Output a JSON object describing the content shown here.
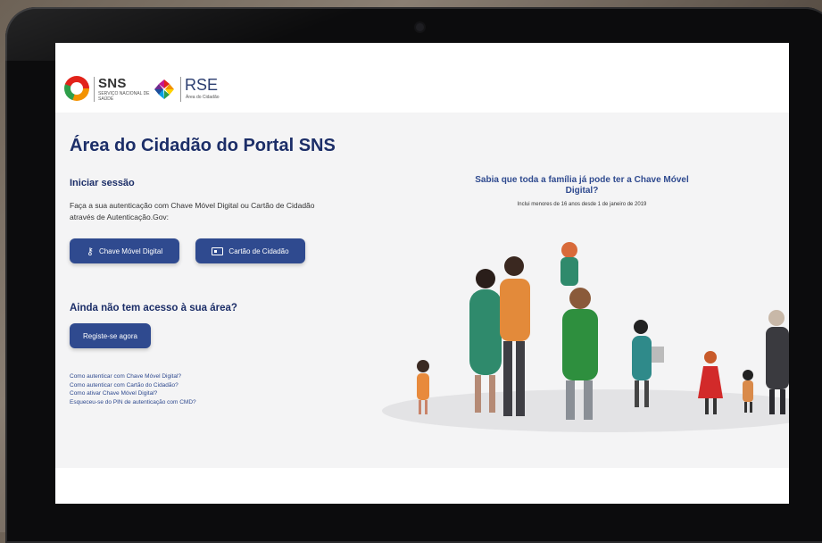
{
  "header": {
    "sns_title": "SNS",
    "sns_subtitle": "SERVIÇO NACIONAL DE SAÚDE",
    "rse_title": "RSE",
    "rse_subtitle": "Área do Cidadão"
  },
  "page_title": "Área do Cidadão do Portal SNS",
  "login": {
    "section_title": "Iniciar sessão",
    "intro": "Faça a sua autenticação com Chave Móvel Digital ou Cartão de Cidadão através de Autenticação.Gov:",
    "cmd_button": "Chave Móvel Digital",
    "cc_button": "Cartão de Cidadão"
  },
  "register": {
    "section_title": "Ainda não tem acesso à sua área?",
    "button": "Registe-se agora"
  },
  "help_links": [
    "Como autenticar com Chave Móvel Digital?",
    "Como autenticar com Cartão do Cidadão?",
    "Como ativar Chave Móvel Digital?",
    "Esqueceu-se do PIN de autenticação com CMD?"
  ],
  "promo": {
    "title": "Sabia que toda a família já pode ter a Chave Móvel Digital?",
    "subtitle": "Inclui menores de 16 anos desde 1 de janeiro de 2019"
  },
  "colors": {
    "primary": "#2f4a8f",
    "title": "#1c2e68",
    "background": "#f4f4f5"
  }
}
